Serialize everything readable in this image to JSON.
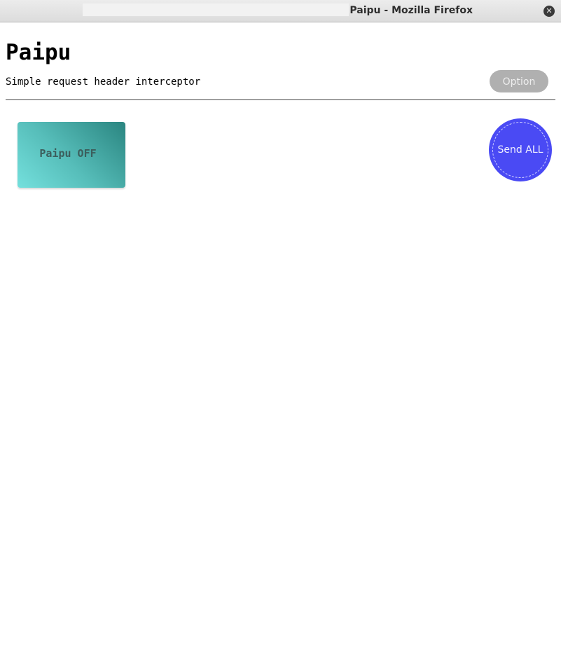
{
  "window": {
    "title": "Paipu - Mozilla Firefox",
    "close_glyph": "✕"
  },
  "page": {
    "title": "Paipu",
    "subtitle": "Simple request header interceptor",
    "option_label": "Option",
    "toggle_label": "Paipu OFF",
    "send_all_label": "Send ALL"
  },
  "colors": {
    "send_all_bg": "#4a4af4",
    "option_bg": "#b0b0b0",
    "toggle_gradient_start": "#74e0dd",
    "toggle_gradient_end": "#2a8580"
  }
}
